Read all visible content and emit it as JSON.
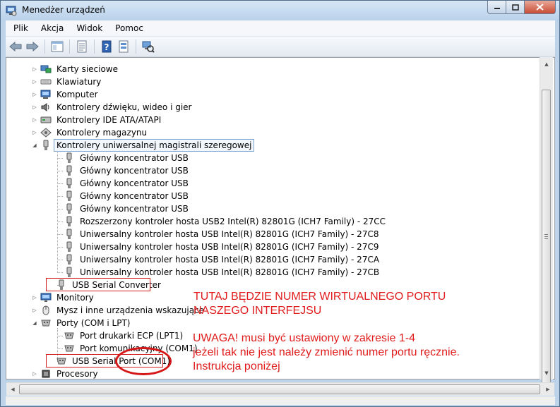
{
  "window": {
    "title": "Menedżer urządzeń"
  },
  "menu": [
    "Plik",
    "Akcja",
    "Widok",
    "Pomoc"
  ],
  "tree": {
    "categories_top": [
      {
        "label": "Karty sieciowe",
        "icon": "network-adapter-icon"
      },
      {
        "label": "Klawiatury",
        "icon": "keyboard-icon"
      },
      {
        "label": "Komputer",
        "icon": "computer-icon"
      },
      {
        "label": "Kontrolery dźwięku, wideo i gier",
        "icon": "sound-icon"
      },
      {
        "label": "Kontrolery IDE ATA/ATAPI",
        "icon": "ide-controller-icon"
      },
      {
        "label": "Kontrolery magazynu",
        "icon": "storage-controller-icon"
      }
    ],
    "usb_controllers": {
      "label": "Kontrolery uniwersalnej magistrali szeregowej",
      "children": [
        "Główny koncentrator USB",
        "Główny koncentrator USB",
        "Główny koncentrator USB",
        "Główny koncentrator USB",
        "Główny koncentrator USB",
        "Rozszerzony kontroler hosta USB2 Intel(R) 82801G (ICH7 Family) - 27CC",
        "Uniwersalny kontroler hosta USB Intel(R) 82801G (ICH7 Family) - 27C8",
        "Uniwersalny kontroler hosta USB Intel(R) 82801G (ICH7 Family) - 27C9",
        "Uniwersalny kontroler hosta USB Intel(R) 82801G (ICH7 Family) - 27CA",
        "Uniwersalny kontroler hosta USB Intel(R) 82801G (ICH7 Family) - 27CB",
        "USB Serial Converter"
      ]
    },
    "monitors": "Monitory",
    "mice": "Mysz i inne urządzenia wskazujące",
    "ports": {
      "label": "Porty (COM i LPT)",
      "children": [
        "Port drukarki ECP (LPT1)",
        "Port komunikacyjny (COM1)",
        "USB Serial Port (COM1)"
      ]
    },
    "processors": "Procesory"
  },
  "annotations": {
    "line1": "TUTAJ BĘDZIE NUMER WIRTUALNEGO PORTU",
    "line2": "NASZEGO INTERFEJSU",
    "line3": "UWAGA! musi być ustawiony w zakresie 1-4",
    "line4": "jeżeli tak nie jest należy zmienić numer portu ręcznie.",
    "line5": "Instrukcja poniżej"
  },
  "colors": {
    "annotation": "#e11b1b",
    "titlebar": "#bcd3ea",
    "close": "#c74c35"
  }
}
